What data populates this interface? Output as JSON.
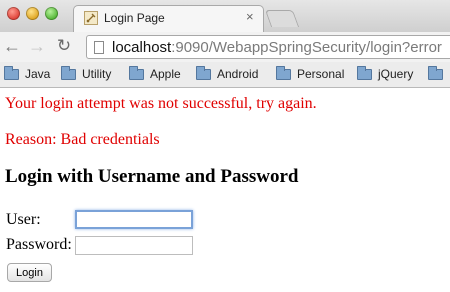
{
  "browser": {
    "tab": {
      "title": "Login Page",
      "close": "×"
    },
    "nav": {
      "back": "←",
      "forward": "→",
      "reload": "↻"
    },
    "address": {
      "host": "localhost",
      "rest": ":9090/WebappSpringSecurity/login?error"
    },
    "bookmarks": [
      {
        "label": "Java"
      },
      {
        "label": "Utility"
      },
      {
        "label": "Apple"
      },
      {
        "label": "Android"
      },
      {
        "label": "Personal"
      },
      {
        "label": "jQuery"
      }
    ]
  },
  "page": {
    "error_message": "Your login attempt was not successful, try again.",
    "reason": "Reason: Bad credentials",
    "heading": "Login with Username and Password",
    "form": {
      "user_label": "User:",
      "user_value": "",
      "password_label": "Password:",
      "password_value": "",
      "submit_label": "Login"
    }
  },
  "colors": {
    "error_text": "#e00000",
    "focus_ring": "#7aa2d8",
    "bookmark_folder": "#7fa6cf"
  }
}
